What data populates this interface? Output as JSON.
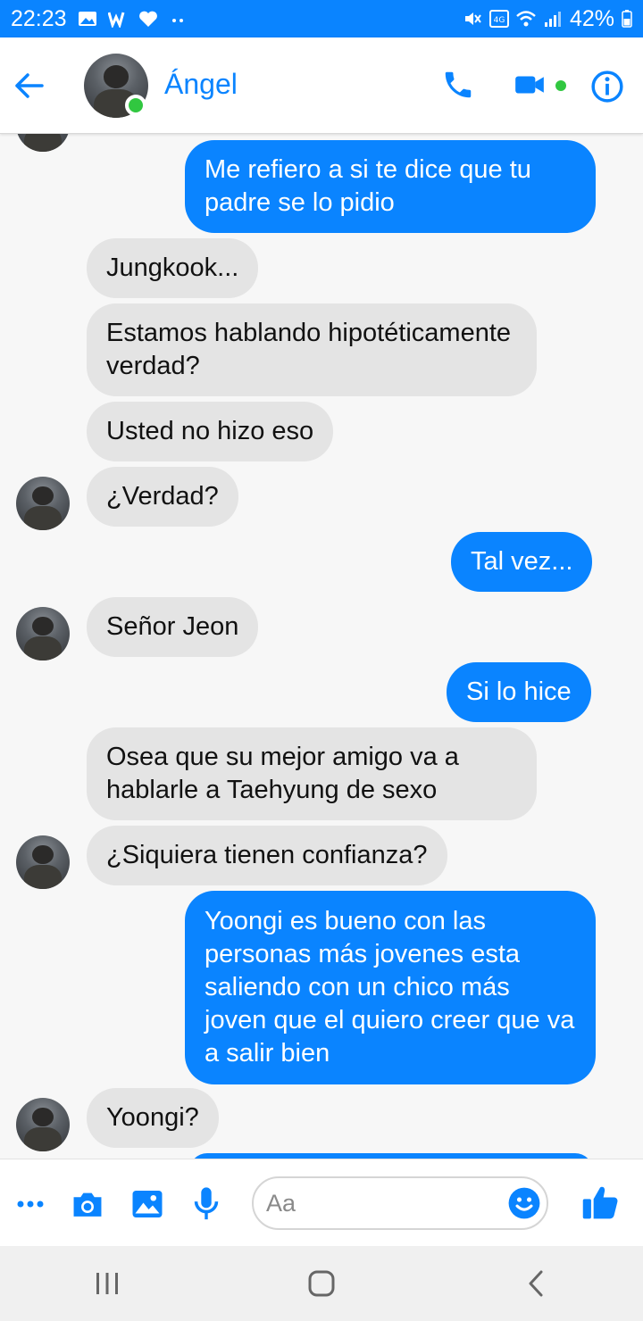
{
  "status_bar": {
    "time": "22:23",
    "battery": "42%",
    "left_icons": [
      "gallery-icon",
      "w-icon",
      "heart-icon",
      "more-icon"
    ],
    "right_icons": [
      "mute-icon",
      "volte-icon",
      "wifi-icon",
      "signal-icon",
      "battery-icon"
    ]
  },
  "header": {
    "contact_name": "Ángel",
    "online": true,
    "icons": [
      "back-arrow-icon",
      "phone-icon",
      "video-camera-icon",
      "info-icon"
    ]
  },
  "messages": [
    {
      "side": "out",
      "text": "Me refiero a si te dice que tu padre se lo pidio"
    },
    {
      "side": "in",
      "text": "Jungkook..."
    },
    {
      "side": "in",
      "text": "Estamos hablando hipotéticamente verdad?"
    },
    {
      "side": "in",
      "text": "Usted no hizo eso"
    },
    {
      "side": "in",
      "text": "¿Verdad?"
    },
    {
      "side": "out",
      "text": "Tal vez..."
    },
    {
      "side": "in",
      "text": "Señor Jeon"
    },
    {
      "side": "out",
      "text": "Si lo hice"
    },
    {
      "side": "in",
      "text": "Osea que su mejor amigo va a hablarle a Taehyung de sexo"
    },
    {
      "side": "in",
      "text": "¿Siquiera tienen confianza?"
    },
    {
      "side": "out",
      "text": "Yoongi es bueno con las personas más jovenes esta saliendo con un chico más joven que el quiero creer que va a salir bien"
    },
    {
      "side": "in",
      "text": "Yoongi?"
    }
  ],
  "composer": {
    "placeholder": "Aa",
    "icons": [
      "more-dots-icon",
      "camera-icon",
      "image-icon",
      "microphone-icon",
      "emoji-icon",
      "thumbs-up-icon"
    ]
  },
  "navigation": {
    "icons": [
      "recent-apps-icon",
      "home-icon",
      "back-icon"
    ]
  },
  "colors": {
    "accent": "#0a84ff",
    "incoming_bubble": "#e4e4e4",
    "online": "#31c740"
  }
}
